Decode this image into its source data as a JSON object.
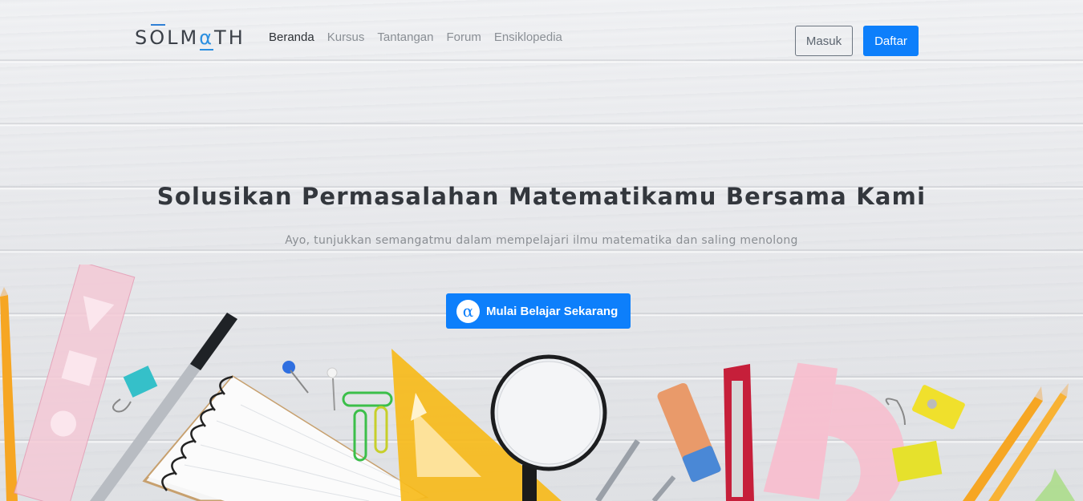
{
  "brand": {
    "logo_text_1": "S",
    "logo_text_2": "O",
    "logo_text_3": "LM",
    "logo_alpha": "α",
    "logo_text_4": "TH"
  },
  "nav": {
    "items": [
      {
        "label": "Beranda",
        "active": true
      },
      {
        "label": "Kursus",
        "active": false
      },
      {
        "label": "Tantangan",
        "active": false
      },
      {
        "label": "Forum",
        "active": false
      },
      {
        "label": "Ensiklopedia",
        "active": false
      }
    ],
    "login_label": "Masuk",
    "register_label": "Daftar"
  },
  "hero": {
    "title": "Solusikan Permasalahan Matematikamu Bersama Kami",
    "subtitle": "Ayo, tunjukkan semangatmu dalam mempelajari ilmu matematika dan saling menolong",
    "cta_label": "Mulai Belajar Sekarang",
    "cta_icon": "α"
  },
  "colors": {
    "accent": "#0d7ffb",
    "text_dark": "#33373d",
    "text_muted": "#8a8f95"
  },
  "icons": {
    "cta_icon": "alpha-icon"
  }
}
